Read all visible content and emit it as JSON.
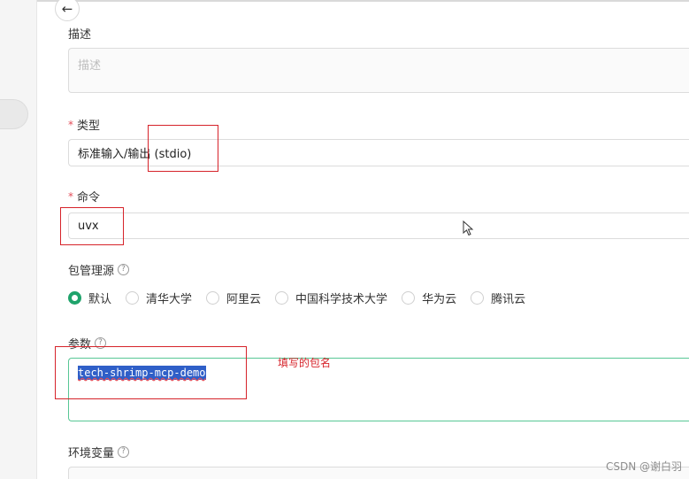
{
  "form": {
    "description": {
      "label": "描述",
      "placeholder": "描述"
    },
    "type": {
      "label": "类型",
      "value": "标准输入/输出 (stdio)"
    },
    "command": {
      "label": "命令",
      "value": "uvx"
    },
    "package_source": {
      "label": "包管理源",
      "selected": "默认",
      "options": [
        "默认",
        "清华大学",
        "阿里云",
        "中国科学技术大学",
        "华为云",
        "腾讯云"
      ]
    },
    "args": {
      "label": "参数",
      "value": "tech-shrimp-mcp-demo"
    },
    "env": {
      "label": "环境变量"
    }
  },
  "annotation": {
    "note": "填写的包名",
    "color": "#d6232a"
  },
  "watermark": "CSDN @谢白羽",
  "icons": {
    "back": "arrow-left-icon",
    "help": "question-circle-icon",
    "cursor": "mouse-pointer-icon"
  },
  "colors": {
    "accent": "#1fa36b",
    "required": "#e34d59",
    "selection": "#2f5fc8"
  }
}
